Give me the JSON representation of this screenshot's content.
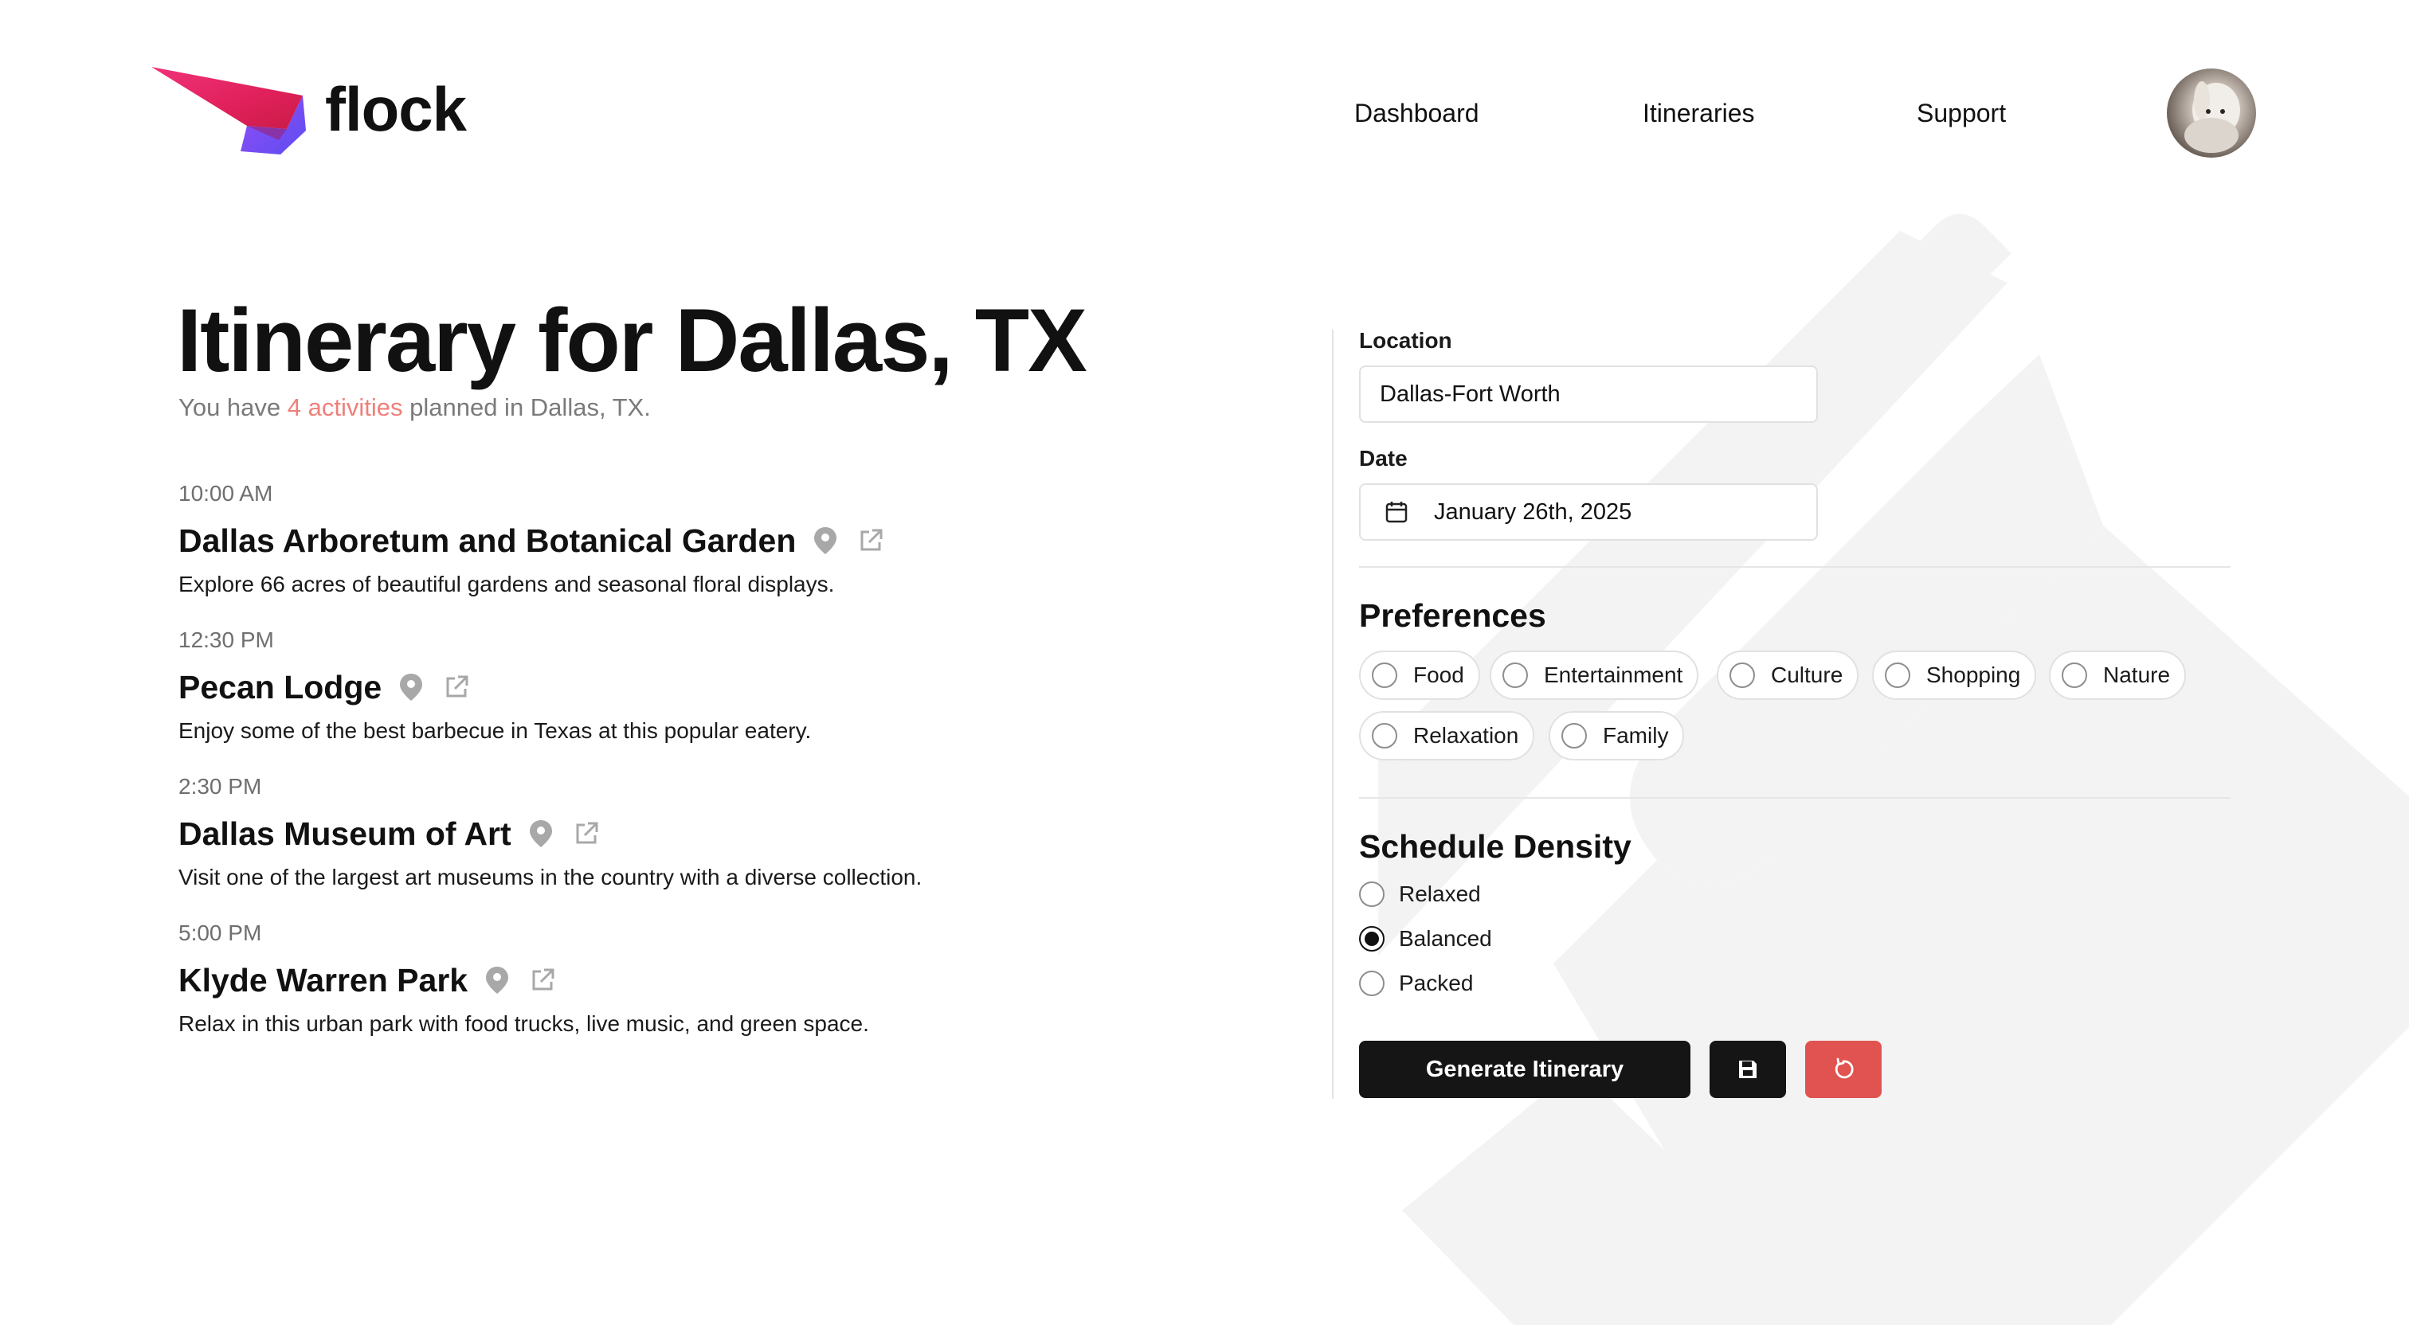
{
  "brand": {
    "name": "flock"
  },
  "nav": {
    "items": [
      {
        "label": "Dashboard"
      },
      {
        "label": "Itineraries"
      },
      {
        "label": "Support"
      }
    ]
  },
  "itinerary": {
    "title": "Itinerary for Dallas, TX",
    "summary_prefix": "You have ",
    "summary_count": "4 activities",
    "summary_suffix": " planned in Dallas, TX.",
    "activities": [
      {
        "time": "10:00 AM",
        "name": "Dallas Arboretum and Botanical Garden",
        "description": "Explore 66 acres of beautiful gardens and seasonal floral displays."
      },
      {
        "time": "12:30 PM",
        "name": "Pecan Lodge",
        "description": "Enjoy some of the best barbecue in Texas at this popular eatery."
      },
      {
        "time": "2:30 PM",
        "name": "Dallas Museum of Art",
        "description": "Visit one of the largest art museums in the country with a diverse collection."
      },
      {
        "time": "5:00 PM",
        "name": "Klyde Warren Park",
        "description": "Relax in this urban park with food trucks, live music, and green space."
      }
    ]
  },
  "form": {
    "location_label": "Location",
    "location_value": "Dallas-Fort Worth",
    "date_label": "Date",
    "date_value": "January 26th, 2025",
    "preferences_title": "Preferences",
    "preferences": [
      {
        "label": "Food",
        "checked": false
      },
      {
        "label": "Entertainment",
        "checked": false
      },
      {
        "label": "Culture",
        "checked": false
      },
      {
        "label": "Shopping",
        "checked": false
      },
      {
        "label": "Nature",
        "checked": false
      },
      {
        "label": "Relaxation",
        "checked": false
      },
      {
        "label": "Family",
        "checked": false
      }
    ],
    "density_title": "Schedule Density",
    "density_options": [
      {
        "label": "Relaxed",
        "selected": false
      },
      {
        "label": "Balanced",
        "selected": true
      },
      {
        "label": "Packed",
        "selected": false
      }
    ],
    "generate_label": "Generate Itinerary",
    "save_icon": "save-icon",
    "reset_icon": "reset-icon"
  },
  "colors": {
    "accent": "#ef7f7a",
    "primary_button": "#151515",
    "reset_button": "#e05350",
    "logo_gradient_start": "#f0327a",
    "logo_gradient_end": "#5b3df5"
  }
}
